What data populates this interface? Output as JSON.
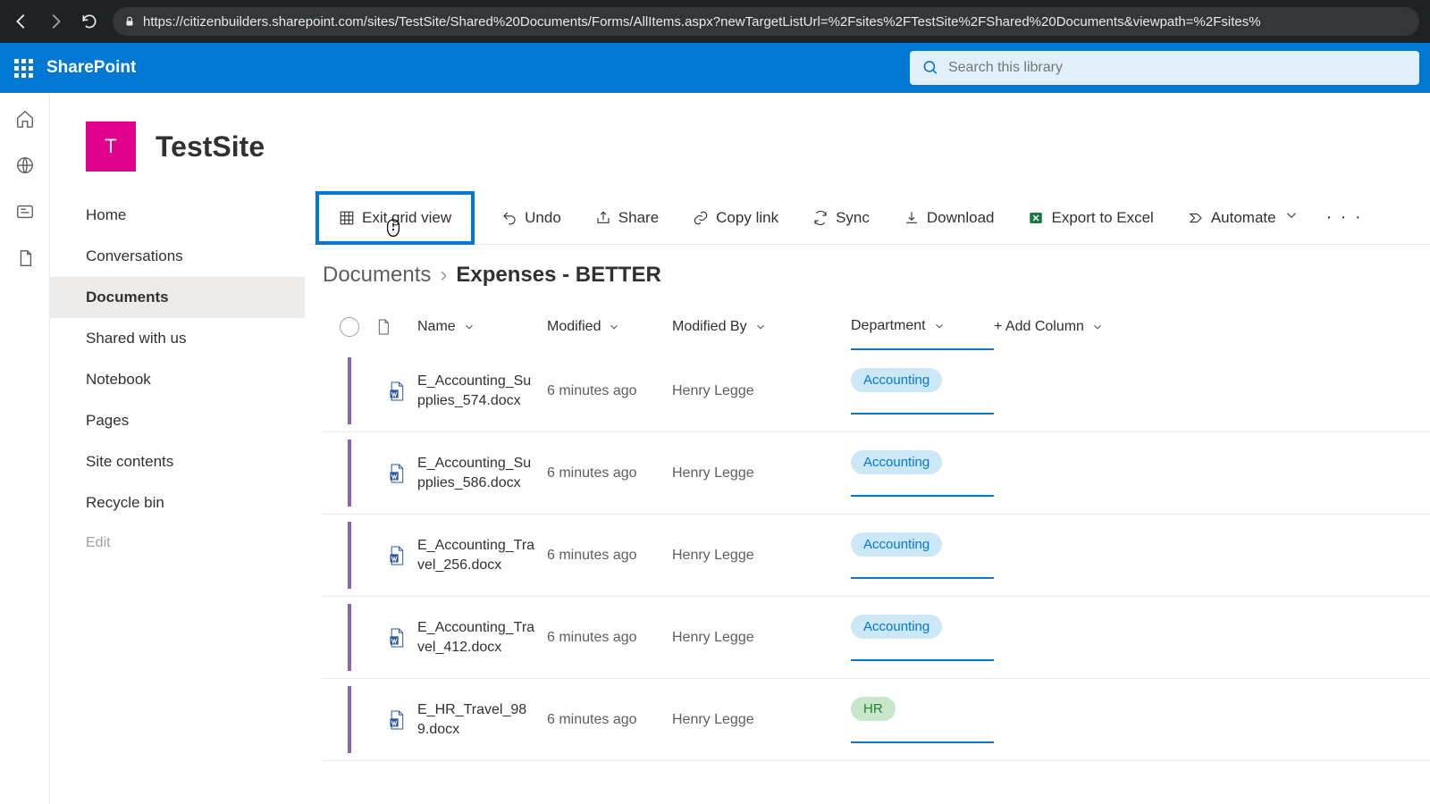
{
  "browser": {
    "url": "https://citizenbuilders.sharepoint.com/sites/TestSite/Shared%20Documents/Forms/AllItems.aspx?newTargetListUrl=%2Fsites%2FTestSite%2FShared%20Documents&viewpath=%2Fsites%"
  },
  "header": {
    "brand": "SharePoint",
    "search_placeholder": "Search this library"
  },
  "site": {
    "logo_letter": "T",
    "title": "TestSite"
  },
  "nav": {
    "items": [
      "Home",
      "Conversations",
      "Documents",
      "Shared with us",
      "Notebook",
      "Pages",
      "Site contents",
      "Recycle bin"
    ],
    "active_index": 2,
    "edit_label": "Edit"
  },
  "toolbar": {
    "exit_grid": "Exit grid view",
    "undo": "Undo",
    "share": "Share",
    "copy_link": "Copy link",
    "sync": "Sync",
    "download": "Download",
    "export_excel": "Export to Excel",
    "automate": "Automate"
  },
  "breadcrumb": {
    "root": "Documents",
    "current": "Expenses - BETTER"
  },
  "columns": {
    "name": "Name",
    "modified": "Modified",
    "modified_by": "Modified By",
    "department": "Department",
    "add_column": "+ Add Column"
  },
  "rows": [
    {
      "name": "E_Accounting_Supplies_574.docx",
      "modified": "6 minutes ago",
      "modified_by": "Henry Legge",
      "department": "Accounting",
      "dept_class": "accounting"
    },
    {
      "name": "E_Accounting_Supplies_586.docx",
      "modified": "6 minutes ago",
      "modified_by": "Henry Legge",
      "department": "Accounting",
      "dept_class": "accounting"
    },
    {
      "name": "E_Accounting_Travel_256.docx",
      "modified": "6 minutes ago",
      "modified_by": "Henry Legge",
      "department": "Accounting",
      "dept_class": "accounting"
    },
    {
      "name": "E_Accounting_Travel_412.docx",
      "modified": "6 minutes ago",
      "modified_by": "Henry Legge",
      "department": "Accounting",
      "dept_class": "accounting"
    },
    {
      "name": "E_HR_Travel_989.docx",
      "modified": "6 minutes ago",
      "modified_by": "Henry Legge",
      "department": "HR",
      "dept_class": "hr"
    }
  ]
}
